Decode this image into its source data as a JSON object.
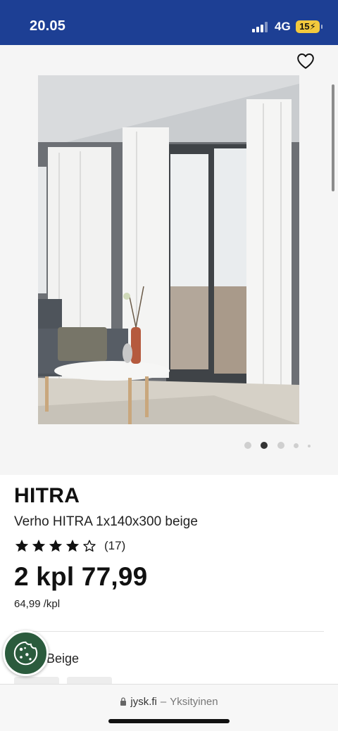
{
  "status_bar": {
    "time": "20.05",
    "network": "4G",
    "battery": "15"
  },
  "product": {
    "brand": "HITRA",
    "title": "Verho HITRA 1x140x300 beige",
    "rating_stars": 4,
    "rating_max": 5,
    "review_count": "(17)",
    "price": "2 kpl 77,99",
    "unit_price": "64,99 /kpl",
    "color": "Beige"
  },
  "gallery": {
    "image_count": 5,
    "active_index": 1,
    "image_alt": "White curtains by large windows"
  },
  "browser": {
    "domain": "jysk.fi",
    "separator": "–",
    "mode": "Yksityinen"
  },
  "icons": {
    "wishlist": "heart-icon",
    "cookie": "cookie-icon",
    "lock": "lock-icon",
    "star_full": "star-filled-icon",
    "star_empty": "star-outline-icon"
  },
  "colors": {
    "status_bar": "#1d3f94",
    "cookie_button": "#2b5b3d",
    "battery": "#f3c93d"
  }
}
